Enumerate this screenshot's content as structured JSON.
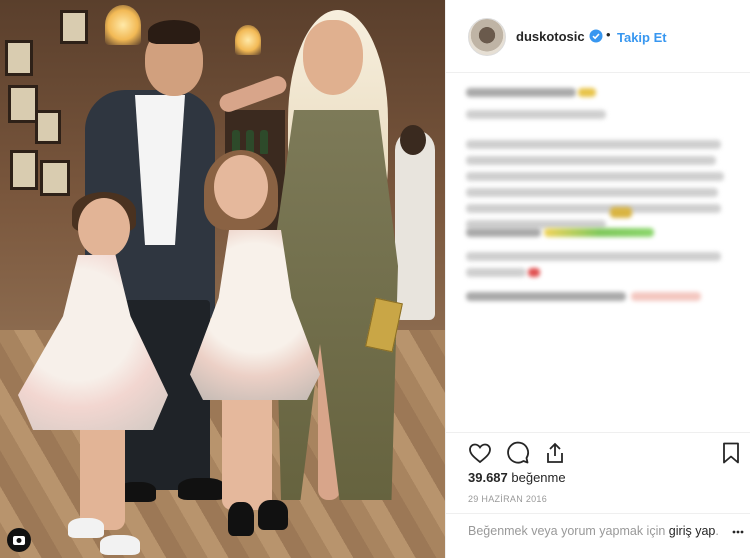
{
  "post": {
    "username": "duskotosic",
    "follow_label": "Takip Et",
    "separator": "•",
    "likes_count": "39.687",
    "likes_label": "beğenme",
    "date": "29 HAZİRAN 2016",
    "login_prefix": "Beğenmek veya yorum yapmak için",
    "login_link": "giriş yap",
    "login_suffix": "."
  },
  "icons": {
    "verified": "verified-badge-icon",
    "like": "heart-icon",
    "comment": "comment-icon",
    "share": "share-icon",
    "save": "bookmark-icon",
    "more": "more-icon"
  },
  "colors": {
    "link_blue": "#3897f0",
    "text": "#262626",
    "muted": "#999999",
    "border": "#efefef"
  }
}
